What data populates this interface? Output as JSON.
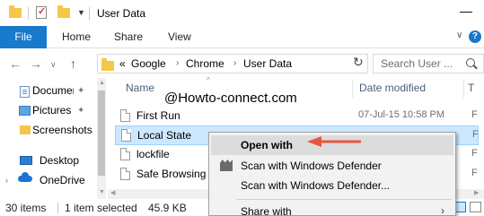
{
  "window": {
    "title": "User Data",
    "minimize": "—"
  },
  "ribbon": {
    "tabs": [
      "File",
      "Home",
      "Share",
      "View"
    ]
  },
  "address": {
    "prefix": "«",
    "crumbs": [
      "Google",
      "Chrome",
      "User Data"
    ],
    "search_placeholder": "Search User ..."
  },
  "navigation": {
    "items": [
      {
        "label": "Documents",
        "pinned": true
      },
      {
        "label": "Pictures",
        "pinned": true
      },
      {
        "label": "Screenshots",
        "pinned": false
      },
      {
        "label": "Desktop",
        "pinned": false
      },
      {
        "label": "OneDrive",
        "pinned": false
      }
    ]
  },
  "file_list": {
    "columns": [
      "Name",
      "Date modified",
      "T"
    ],
    "watermark": "@Howto-connect.com",
    "rows": [
      {
        "name": "First Run",
        "date": "07-Jul-15 10:58 PM",
        "type": "F",
        "selected": false
      },
      {
        "name": "Local State",
        "date": "",
        "type": "F",
        "selected": true
      },
      {
        "name": "lockfile",
        "date": "",
        "type": "F",
        "selected": false
      },
      {
        "name": "Safe Browsing",
        "date": "",
        "type": "F",
        "selected": false
      }
    ]
  },
  "status": {
    "items_count": "30 items",
    "selected": "1 item selected",
    "size": "45.9 KB"
  },
  "context_menu": {
    "items": [
      {
        "label": "Open with",
        "bold": true,
        "icon": "",
        "submenu": false
      },
      {
        "label": "Scan with Windows Defender",
        "bold": false,
        "icon": "defender-icon",
        "submenu": false
      },
      {
        "label": "Scan with Windows Defender...",
        "bold": false,
        "icon": "",
        "submenu": false
      },
      {
        "label": "Share with",
        "bold": false,
        "icon": "",
        "submenu": true
      }
    ]
  },
  "colors": {
    "accent": "#1979ca",
    "selection": "#cce8ff",
    "annotation_arrow": "#e8553f"
  }
}
